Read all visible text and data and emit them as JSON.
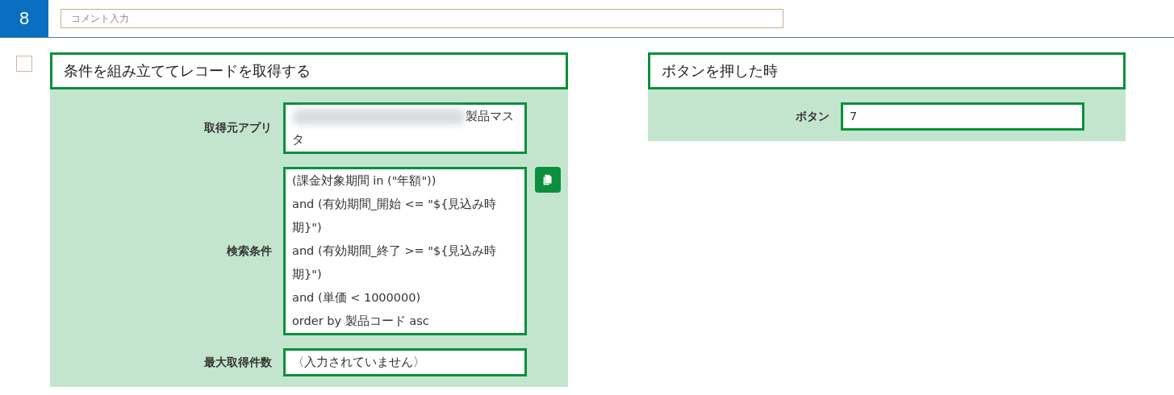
{
  "step": {
    "number": "8",
    "comment": {
      "placeholder": "コメント入力"
    }
  },
  "actions": [
    {
      "checked": false,
      "title": "条件を組み立ててレコードを取得する",
      "fields": [
        {
          "label": "取得元アプリ",
          "redacted": true,
          "value": "製品マスタ",
          "copy": false
        },
        {
          "label": "検索条件",
          "redacted": false,
          "value": "(課金対象期間 in (\"年額\"))\nand (有効期間_開始 <= \"${見込み時期}\")\nand (有効期間_終了 >= \"${見込み時期}\")\nand (単価 < 1000000)\norder by 製品コード asc",
          "copy": true
        },
        {
          "label": "最大取得件数",
          "redacted": false,
          "value": "〈入力されていません〉",
          "copy": false
        }
      ]
    },
    {
      "title": "ボタンを押した時",
      "fields": [
        {
          "label": "ボタン",
          "redacted": false,
          "value": "7",
          "copy": false
        }
      ]
    }
  ]
}
